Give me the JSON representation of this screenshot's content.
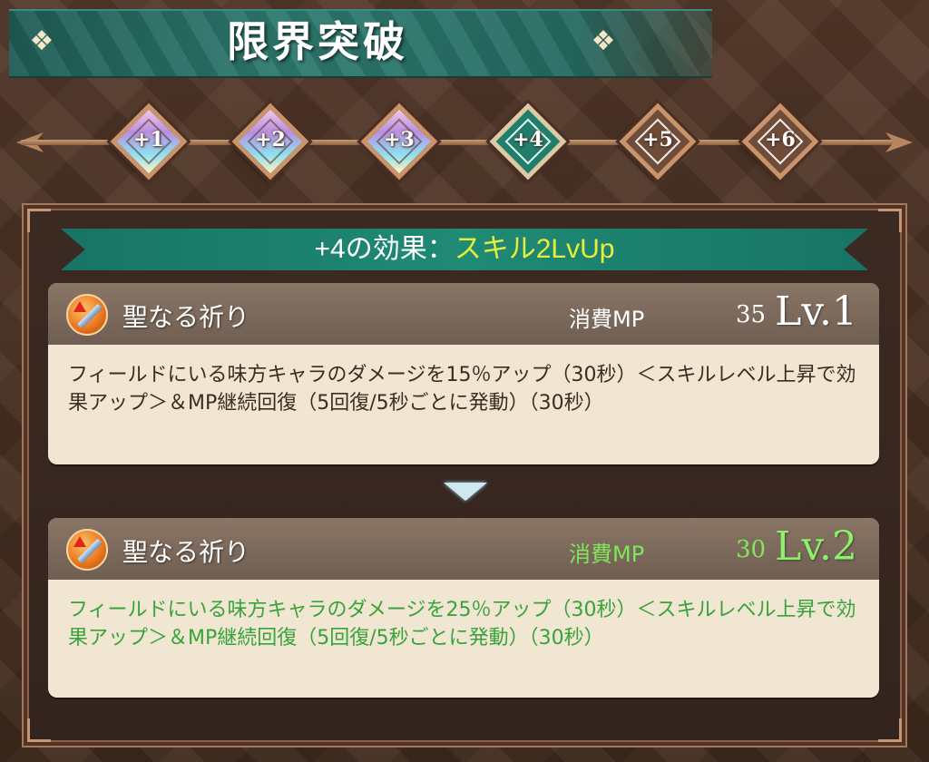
{
  "title": "限界突破",
  "ranks": [
    {
      "label": "+1",
      "state": "done"
    },
    {
      "label": "+2",
      "state": "done"
    },
    {
      "label": "+3",
      "state": "done"
    },
    {
      "label": "+4",
      "state": "active"
    },
    {
      "label": "+5",
      "state": "locked"
    },
    {
      "label": "+6",
      "state": "locked"
    }
  ],
  "effect": {
    "prefix": "+4の効果：",
    "highlight": "スキル2LvUp"
  },
  "current_skill": {
    "name": "聖なる祈り",
    "mp_label": "消費MP",
    "mp_value": "35",
    "level": "Lv.1",
    "description": "フィールドにいる味方キャラのダメージを15％アップ（30秒）＜スキルレベル上昇で効果アップ＞＆MP継続回復（5回復/5秒ごとに発動）（30秒）"
  },
  "next_skill": {
    "name": "聖なる祈り",
    "mp_label": "消費MP",
    "mp_value": "30",
    "level": "Lv.2",
    "description": "フィールドにいる味方キャラのダメージを25％アップ（30秒）＜スキルレベル上昇で効果アップ＞＆MP継続回復（5回復/5秒ごとに発動）（30秒）"
  },
  "colors": {
    "accent_green": "#1f8a75",
    "highlight_yellow": "#e8ee3a",
    "upgrade_green": "#38a33a"
  }
}
